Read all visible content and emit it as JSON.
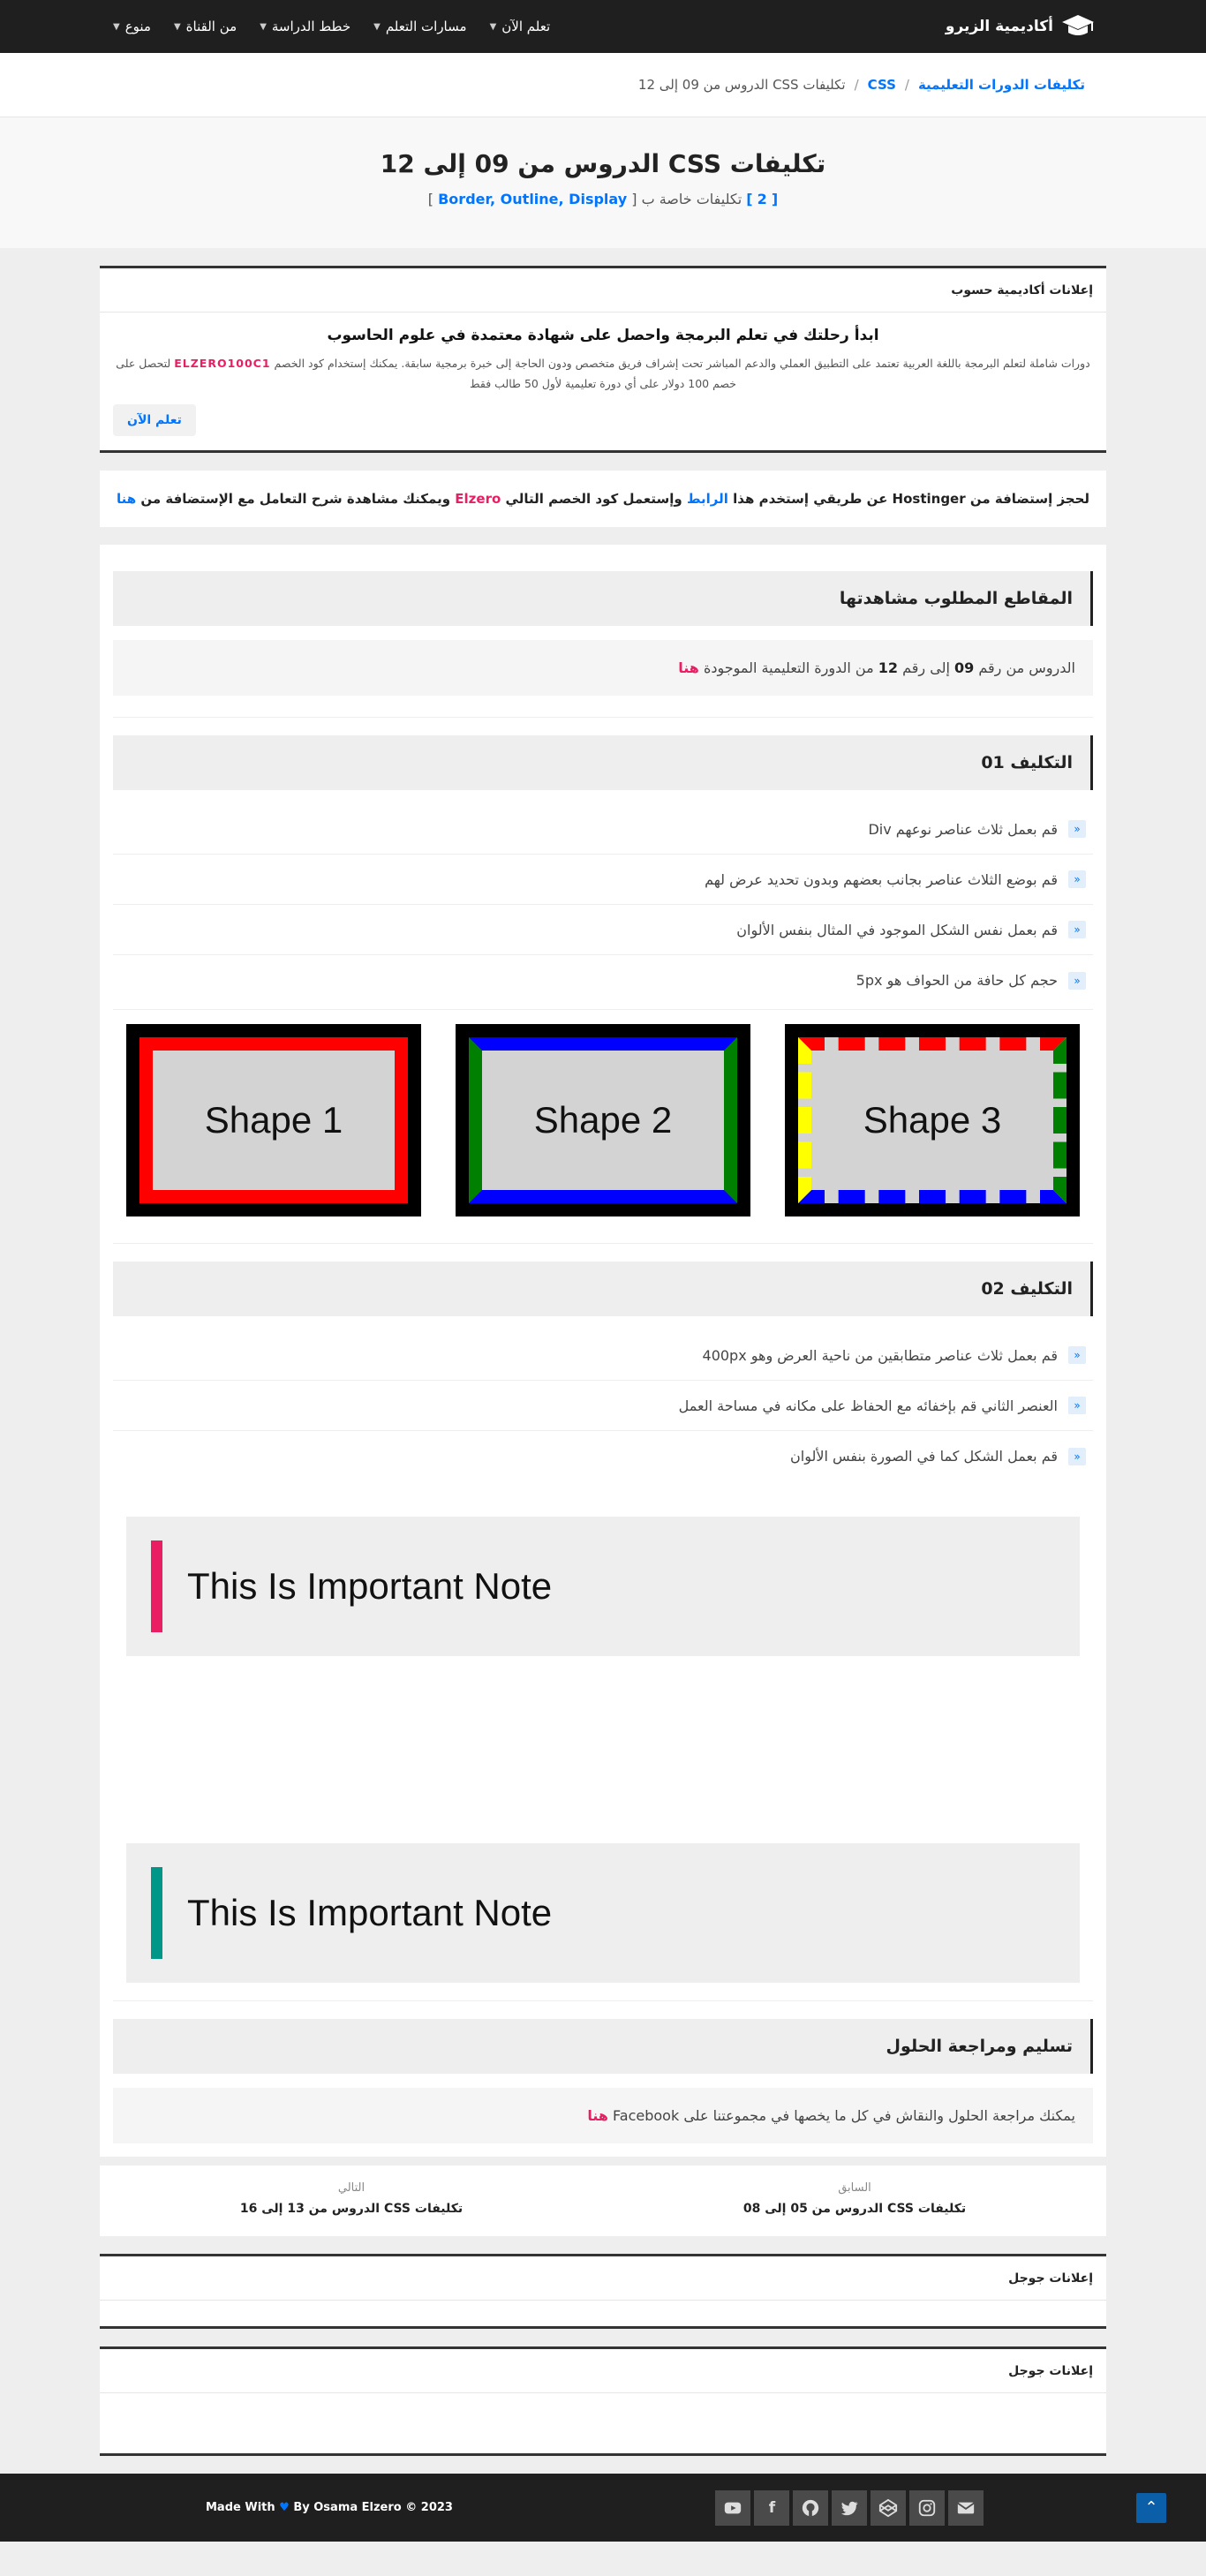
{
  "navbar": {
    "logo_text": "أكاديمية الزيرو",
    "menu": [
      {
        "label": "تعلم الآن"
      },
      {
        "label": "مسارات التعلم"
      },
      {
        "label": "خطط الدراسة"
      },
      {
        "label": "من القناة"
      },
      {
        "label": "منوع"
      }
    ]
  },
  "breadcrumb": {
    "root": "تكليفات الدورات التعليمية",
    "sep": "/",
    "category": "CSS",
    "current": "تكليفات CSS الدروس من 09 إلى 12"
  },
  "hero": {
    "title": "تكليفات CSS الدروس من 09 إلى 12",
    "sub_open": "[",
    "count": "2",
    "sub_close": "]",
    "sub_text": "تكليفات خاصة ب [",
    "topics": "Border, Outline, Display",
    "sub_end": "]"
  },
  "ad": {
    "header": "إعلانات أكاديمية حسوب",
    "headline": "ابدأ رحلتك في تعلم البرمجة واحصل على شهادة معتمدة في علوم الحاسوب",
    "text_before": "دورات شاملة لتعلم البرمجة باللغة العربية تعتمد على التطبيق العملي والدعم المباشر تحت إشراف فريق متخصص ودون الحاجة إلى خبرة برمجية سابقة. يمكنك إستخدام كود الخصم",
    "code": "ELZERO100C1",
    "text_after": "لتحصل على خصم 100 دولار على أي دورة تعليمية لأول 50 طالب فقط",
    "button": "تعلم الآن"
  },
  "hosting": {
    "t1": "لحجز إستضافة من Hostinger عن طريقي إستخدم هذا",
    "link": "الرابط",
    "t2": "وإستعمل كود الخصم التالي",
    "code": "Elzero",
    "t3": "ويمكنك مشاهدة شرح التعامل مع الإستضافة من",
    "here": "هنا"
  },
  "section_videos": {
    "title": "المقاطع المطلوب مشاهدتها",
    "t1": "الدروس من رقم",
    "from": "09",
    "t2": "إلى رقم",
    "to": "12",
    "t3": "من الدورة التعليمية الموجودة",
    "here": "هنا"
  },
  "task1": {
    "title": "التكليف 01",
    "items": [
      {
        "text": "قم بعمل ثلاث عناصر نوعهم Div"
      },
      {
        "text": "قم بوضع الثلاث عناصر بجانب بعضهم وبدون تحديد عرض لهم"
      },
      {
        "text": "قم بعمل نفس الشكل الموجود في المثال بنفس الألوان"
      },
      {
        "text": "حجم كل حافة من الحواف هو 5px"
      }
    ],
    "shapes": [
      {
        "label": "Shape 1"
      },
      {
        "label": "Shape 2"
      },
      {
        "label": "Shape 3"
      }
    ]
  },
  "task2": {
    "title": "التكليف 02",
    "items": [
      {
        "text": "قم بعمل ثلاث عناصر متطابقين من ناحية العرض وهو 400px"
      },
      {
        "text": "العنصر الثاني قم بإخفائه مع الحفاظ على مكانه في مساحة العمل"
      },
      {
        "text": "قم بعمل الشكل كما في الصورة بنفس الألوان"
      }
    ],
    "notes": [
      {
        "text": "This Is Important Note",
        "color": "#e91e63"
      },
      {
        "text": "This Is Important Note",
        "color": "#009688"
      }
    ]
  },
  "section_submit": {
    "title": "تسليم ومراجعة الحلول",
    "text": "يمكنك مراجعة الحلول والنقاش في كل ما يخصها في مجموعتنا على Facebook",
    "here": "هنا"
  },
  "pager": {
    "prev_label": "السابق",
    "prev_title": "تكليفات CSS الدروس من 05 إلى 08",
    "next_label": "التالي",
    "next_title": "تكليفات CSS الدروس من 13 إلى 16"
  },
  "google_ads": [
    {
      "header": "إعلانات جوجل"
    },
    {
      "header": "إعلانات جوجل"
    }
  ],
  "footer": {
    "made_with": "Made With",
    "by": "By Osama Elzero © 2023",
    "socials": [
      "youtube-icon",
      "facebook-icon",
      "github-icon",
      "twitter-icon",
      "codepen-icon",
      "instagram-icon",
      "email-icon"
    ]
  },
  "colors": {
    "accent": "#0075ff",
    "highlight": "#e91e63",
    "navbar_bg": "#1f1f1f"
  }
}
